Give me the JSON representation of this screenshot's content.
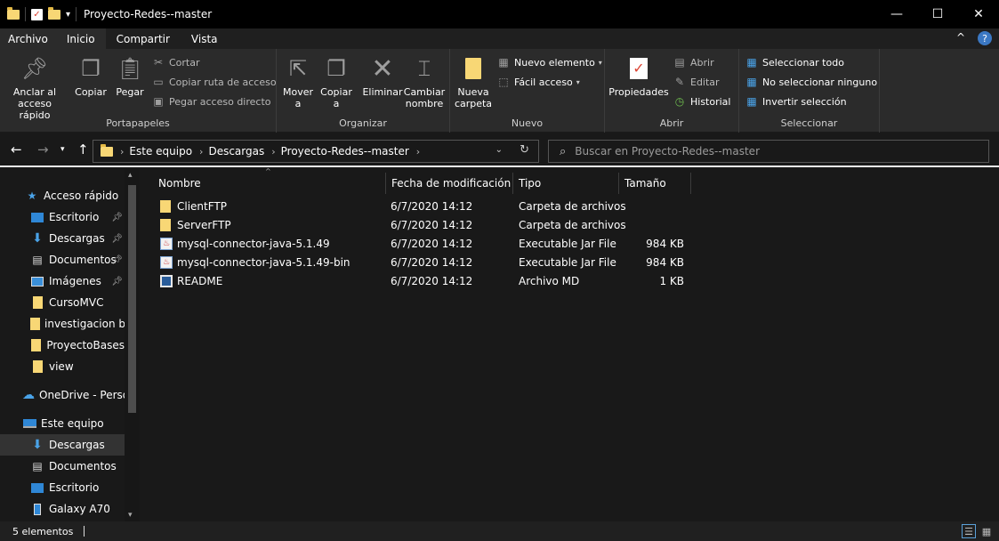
{
  "window": {
    "title": "Proyecto-Redes--master",
    "minimize": "—",
    "maximize": "☐",
    "close": "✕"
  },
  "tabs": {
    "file": "Archivo",
    "items": [
      "Inicio",
      "Compartir",
      "Vista"
    ],
    "collapse": "^",
    "help": "?"
  },
  "ribbon": {
    "portapapeles": {
      "label": "Portapapeles",
      "anclar": "Anclar al acceso rápido",
      "copiar": "Copiar",
      "pegar": "Pegar",
      "cortar": "Cortar",
      "copiar_ruta": "Copiar ruta de acceso",
      "pegar_acceso": "Pegar acceso directo"
    },
    "organizar": {
      "label": "Organizar",
      "mover": "Mover a",
      "copiar": "Copiar a",
      "eliminar": "Eliminar",
      "cambiar": "Cambiar nombre"
    },
    "nuevo": {
      "label": "Nuevo",
      "nueva_carpeta": "Nueva carpeta",
      "nuevo_elemento": "Nuevo elemento",
      "facil_acceso": "Fácil acceso"
    },
    "abrir": {
      "label": "Abrir",
      "propiedades": "Propiedades",
      "abrir": "Abrir",
      "editar": "Editar",
      "historial": "Historial"
    },
    "seleccionar": {
      "label": "Seleccionar",
      "todo": "Seleccionar todo",
      "ninguno": "No seleccionar ninguno",
      "invertir": "Invertir selección"
    }
  },
  "address": {
    "crumbs": [
      "Este equipo",
      "Descargas",
      "Proyecto-Redes--master"
    ],
    "search_placeholder": "Buscar en Proyecto-Redes--master"
  },
  "sidebar": {
    "quick_access": "Acceso rápido",
    "quick_items": [
      "Escritorio",
      "Descargas",
      "Documentos",
      "Imágenes",
      "CursoMVC",
      "investigacion ba",
      "ProyectoBases",
      "view"
    ],
    "onedrive": "OneDrive - Person",
    "this_pc": "Este equipo",
    "pc_items": [
      "Descargas",
      "Documentos",
      "Escritorio",
      "Galaxy A70"
    ]
  },
  "columns": {
    "name": "Nombre",
    "date": "Fecha de modificación",
    "type": "Tipo",
    "size": "Tamaño"
  },
  "files": [
    {
      "name": "ClientFTP",
      "date": "6/7/2020 14:12",
      "type": "Carpeta de archivos",
      "size": "",
      "icon": "folder-icon"
    },
    {
      "name": "ServerFTP",
      "date": "6/7/2020 14:12",
      "type": "Carpeta de archivos",
      "size": "",
      "icon": "folder-icon"
    },
    {
      "name": "mysql-connector-java-5.1.49",
      "date": "6/7/2020 14:12",
      "type": "Executable Jar File",
      "size": "984 KB",
      "icon": "java-jar-icon"
    },
    {
      "name": "mysql-connector-java-5.1.49-bin",
      "date": "6/7/2020 14:12",
      "type": "Executable Jar File",
      "size": "984 KB",
      "icon": "java-jar-icon"
    },
    {
      "name": "README",
      "date": "6/7/2020 14:12",
      "type": "Archivo MD",
      "size": "1 KB",
      "icon": "markdown-file-icon"
    }
  ],
  "status": {
    "count": "5 elementos"
  },
  "colors": {
    "folder": "#f8d775",
    "accent": "#0078d7",
    "background": "#191919",
    "ribbon": "#2b2b2b"
  }
}
